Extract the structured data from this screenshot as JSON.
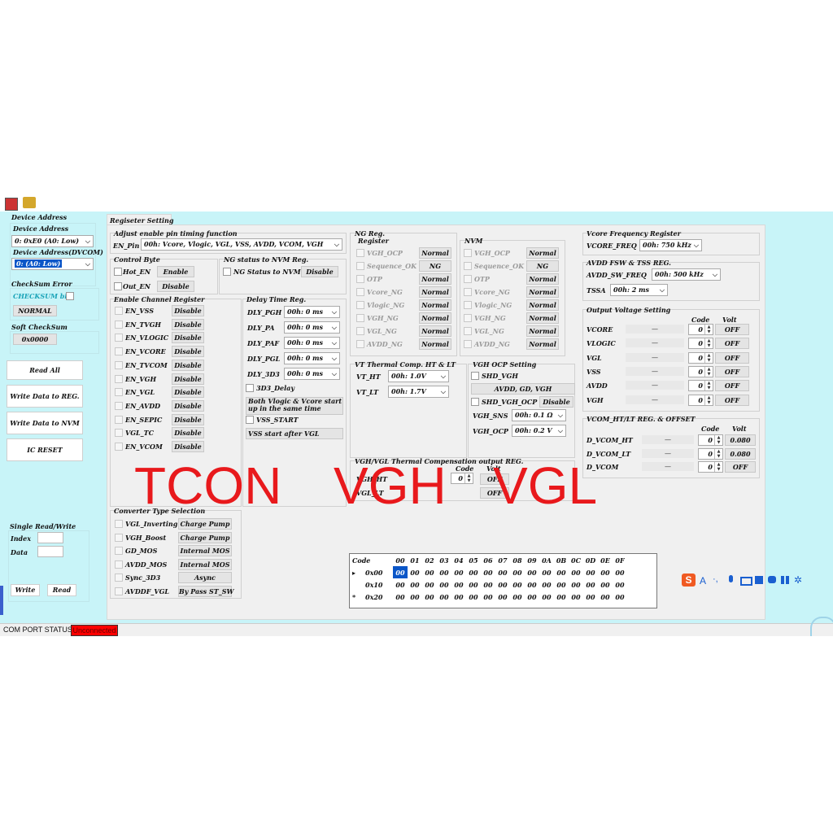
{
  "left": {
    "device_address_title": "Device Address",
    "device_address_label": "Device Address",
    "device_address_value": "0: 0xE0 (A0: Low)",
    "device_address_dvcom_label": "Device Address(DVCOM)",
    "device_address_dvcom_value": "0: (A0: Low)",
    "checksum_error_title": "CheckSum Error",
    "checksum_bit_label": "CHECKSUM bit",
    "normal_label": "NORMAL",
    "soft_checksum_title": "Soft CheckSum",
    "soft_checksum_value": "0x0000",
    "read_all": "Read All",
    "write_reg": "Write Data to REG.",
    "write_nvm": "Write Data to NVM",
    "ic_reset": "IC RESET",
    "single_rw_title": "Single Read/Write",
    "index_label": "Index",
    "data_label": "Data",
    "write_btn": "Write",
    "read_btn": "Read"
  },
  "tab_label": "Regiseter Setting",
  "adjust": {
    "title": "Adjust enable pin timing function",
    "en_pin_label": "EN_Pin",
    "en_pin_value": "00h: Vcore, Vlogic, VGL, VSS, AVDD, VCOM, VGH"
  },
  "control_byte": {
    "title": "Control Byte",
    "items": [
      {
        "label": "Hot_EN",
        "value": "Enable"
      },
      {
        "label": "Out_EN",
        "value": "Disable"
      }
    ]
  },
  "ng_nvm": {
    "title": "NG status to NVM Reg.",
    "label": "NG Status to NVM",
    "value": "Disable"
  },
  "enable_channel": {
    "title": "Enable Channel Register",
    "items": [
      {
        "label": "EN_VSS",
        "value": "Disable"
      },
      {
        "label": "EN_TVGH",
        "value": "Disable"
      },
      {
        "label": "EN_VLOGIC",
        "value": "Disable"
      },
      {
        "label": "EN_VCORE",
        "value": "Disable"
      },
      {
        "label": "EN_TVCOM",
        "value": "Disable"
      },
      {
        "label": "EN_VGH",
        "value": "Disable"
      },
      {
        "label": "EN_VGL",
        "value": "Disable"
      },
      {
        "label": "EN_AVDD",
        "value": "Disable"
      },
      {
        "label": "EN_SEPIC",
        "value": "Disable"
      },
      {
        "label": "VGL_TC",
        "value": "Disable"
      },
      {
        "label": "EN_VCOM",
        "value": "Disable"
      }
    ]
  },
  "delay": {
    "title": "Delay Time Reg.",
    "items": [
      {
        "label": "DLY_PGH",
        "value": "00h: 0 ms"
      },
      {
        "label": "DLY_PA",
        "value": "00h: 0 ms"
      },
      {
        "label": "DLY_PAF",
        "value": "00h: 0 ms"
      },
      {
        "label": "DLY_PGL",
        "value": "00h: 0 ms"
      },
      {
        "label": "DLY_3D3",
        "value": "00h: 0 ms"
      }
    ],
    "d3_delay": "3D3_Delay",
    "both_start": "Both Vlogic & Vcore start up in the same time",
    "vss_start": "VSS_START",
    "vss_after": "VSS start after VGL"
  },
  "ng_reg": {
    "title": "NG Reg.",
    "subtitle": "Register",
    "items": [
      {
        "label": "VGH_OCP",
        "value": "Normal"
      },
      {
        "label": "Sequence_OK",
        "value": "NG"
      },
      {
        "label": "OTP",
        "value": "Normal"
      },
      {
        "label": "Vcore_NG",
        "value": "Normal"
      },
      {
        "label": "Vlogic_NG",
        "value": "Normal"
      },
      {
        "label": "VGH_NG",
        "value": "Normal"
      },
      {
        "label": "VGL_NG",
        "value": "Normal"
      },
      {
        "label": "AVDD_NG",
        "value": "Normal"
      }
    ]
  },
  "nvm": {
    "title": "NVM",
    "items": [
      {
        "label": "VGH_OCP",
        "value": "Normal"
      },
      {
        "label": "Sequence_OK",
        "value": "NG"
      },
      {
        "label": "OTP",
        "value": "Normal"
      },
      {
        "label": "Vcore_NG",
        "value": "Normal"
      },
      {
        "label": "Vlogic_NG",
        "value": "Normal"
      },
      {
        "label": "VGH_NG",
        "value": "Normal"
      },
      {
        "label": "VGL_NG",
        "value": "Normal"
      },
      {
        "label": "AVDD_NG",
        "value": "Normal"
      }
    ]
  },
  "vt_thermal": {
    "title": "VT Thermal Comp. HT & LT",
    "vt_ht_label": "VT_HT",
    "vt_ht_value": "00h: 1.0V",
    "vt_lt_label": "VT_LT",
    "vt_lt_value": "00h: 1.7V"
  },
  "vgh_ocp": {
    "title": "VGH OCP Setting",
    "shd_vgh": "SHD_VGH",
    "avdd_btn": "AVDD, GD, VGH",
    "shd_vgh_ocp": "SHD_VGH_OCP",
    "shd_vgh_ocp_value": "Disable",
    "vgh_sns_label": "VGH_SNS",
    "vgh_sns_value": "00h: 0.1 Ω",
    "vgh_ocp_label": "VGH_OCP",
    "vgh_ocp_value": "00h: 0.2 V"
  },
  "vgh_vgl_thermal": {
    "title": "VGH/VGL Thermal Compensation output REG.",
    "code_label": "Code",
    "volt_label": "Volt",
    "rows": [
      {
        "label": "VGH_HT",
        "code": "0",
        "volt": "OFF"
      },
      {
        "label": "VGL_LT",
        "volt": "OFF"
      }
    ]
  },
  "vcore_freq": {
    "title": "Vcore Frequency Register",
    "label": "VCORE_FREQ",
    "value": "00h: 750 kHz"
  },
  "avdd_fsw": {
    "title": "AVDD FSW & TSS REG.",
    "freq_label": "AVDD_SW_FREQ",
    "freq_value": "00h: 500 kHz",
    "tssa_label": "TSSA",
    "tssa_value": "00h: 2 ms"
  },
  "output_voltage": {
    "title": "Output Voltage Setting",
    "code_label": "Code",
    "volt_label": "Volt",
    "rows": [
      {
        "label": "VCORE",
        "dash": "—",
        "code": "0",
        "volt": "OFF"
      },
      {
        "label": "VLOGIC",
        "dash": "—",
        "code": "0",
        "volt": "OFF"
      },
      {
        "label": "VGL",
        "dash": "—",
        "code": "0",
        "volt": "OFF"
      },
      {
        "label": "VSS",
        "dash": "—",
        "code": "0",
        "volt": "OFF"
      },
      {
        "label": "AVDD",
        "dash": "—",
        "code": "0",
        "volt": "OFF"
      },
      {
        "label": "VGH",
        "dash": "—",
        "code": "0",
        "volt": "OFF"
      }
    ]
  },
  "vcom": {
    "title": "VCOM_HT/LT REG. & OFFSET",
    "code_label": "Code",
    "volt_label": "Volt",
    "rows": [
      {
        "label": "D_VCOM_HT",
        "dash": "—",
        "code": "0",
        "volt": "0.080"
      },
      {
        "label": "D_VCOM_LT",
        "dash": "—",
        "code": "0",
        "volt": "0.080"
      },
      {
        "label": "D_VCOM",
        "dash": "—",
        "code": "0",
        "volt": "OFF"
      }
    ]
  },
  "converter": {
    "title": "Converter Type Selection",
    "items": [
      {
        "label": "VGL_Inverting",
        "value": "Charge Pump"
      },
      {
        "label": "VGH_Boost",
        "value": "Charge Pump"
      },
      {
        "label": "GD_MOS",
        "value": "Internal MOS"
      },
      {
        "label": "AVDD_MOS",
        "value": "Internal MOS"
      },
      {
        "label": "Sync_3D3",
        "value": "Async"
      },
      {
        "label": "AVDDF_VGL",
        "value": "By Pass ST_SW"
      }
    ]
  },
  "grid": {
    "header": [
      "Code",
      "00",
      "01",
      "02",
      "03",
      "04",
      "05",
      "06",
      "07",
      "08",
      "09",
      "0A",
      "0B",
      "0C",
      "0D",
      "0E",
      "0F"
    ],
    "rows": [
      {
        "marker": "▸",
        "code": "0x00",
        "cells": [
          "00",
          "00",
          "00",
          "00",
          "00",
          "00",
          "00",
          "00",
          "00",
          "00",
          "00",
          "00",
          "00",
          "00",
          "00",
          "00"
        ]
      },
      {
        "marker": "",
        "code": "0x10",
        "cells": [
          "00",
          "00",
          "00",
          "00",
          "00",
          "00",
          "00",
          "00",
          "00",
          "00",
          "00",
          "00",
          "00",
          "00",
          "00",
          "00"
        ]
      },
      {
        "marker": "*",
        "code": "0x20",
        "cells": [
          "00",
          "00",
          "00",
          "00",
          "00",
          "00",
          "00",
          "00",
          "00",
          "00",
          "00",
          "00",
          "00",
          "00",
          "00",
          "00"
        ]
      }
    ]
  },
  "overlay_text": {
    "t1": "TCON",
    "t2": "VGH",
    "t3": "VGL"
  },
  "status": {
    "label": "COM PORT STATUS",
    "value": "Unconnected"
  },
  "ime": {
    "a": "A",
    "dot": "·,"
  },
  "colors": {
    "cyan": "#c8f4f8",
    "red_text": "#e8191c",
    "status_red": "#ff0000",
    "select_blue": "#0a56c8"
  }
}
